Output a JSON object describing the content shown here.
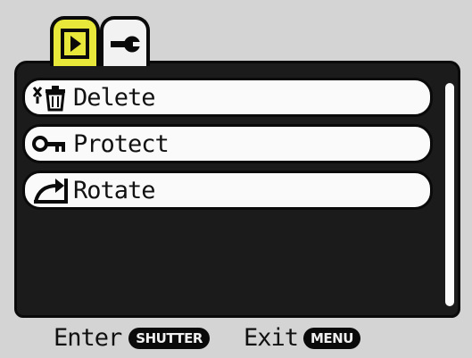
{
  "tabs": [
    {
      "name": "playback",
      "icon": "play-icon",
      "active": true,
      "color": "#e8e83a"
    },
    {
      "name": "setup",
      "icon": "wrench-icon",
      "active": false
    }
  ],
  "menu": {
    "items": [
      {
        "label": "Delete",
        "icon": "delete-icon"
      },
      {
        "label": "Protect",
        "icon": "key-icon"
      },
      {
        "label": "Rotate",
        "icon": "rotate-icon"
      }
    ]
  },
  "footer": {
    "enter_label": "Enter",
    "enter_button": "SHUTTER",
    "exit_label": "Exit",
    "exit_button": "MENU"
  }
}
